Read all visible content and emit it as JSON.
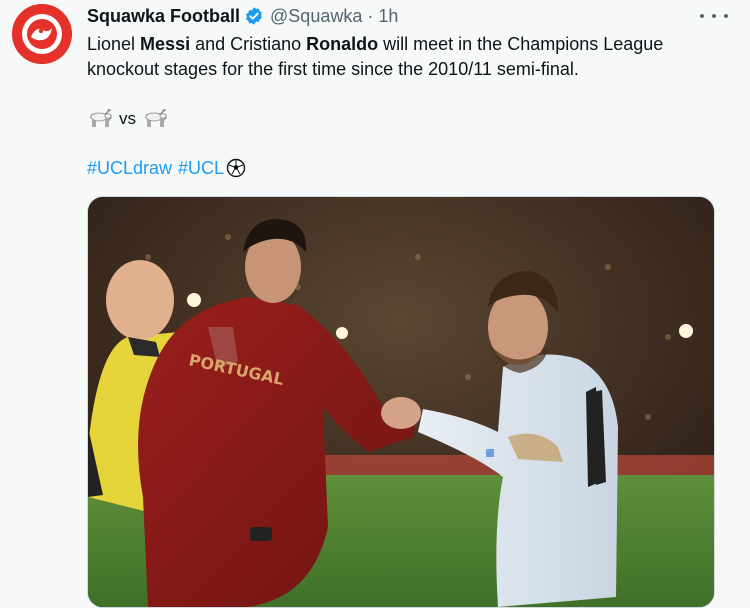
{
  "tweet": {
    "author_name": "Squawka Football",
    "handle": "@Squawka",
    "separator": "·",
    "time": "1h",
    "text": {
      "line1_pre": "Lionel ",
      "line1_bold1": "Messi",
      "line1_mid": " and Cristiano ",
      "line1_bold2": "Ronaldo",
      "line1_post": " will meet in the Champions League",
      "line2": "knockout stages for the first time since the 2010/11 semi-final."
    },
    "vs_text": "vs",
    "hashtags": [
      "#UCLdraw",
      "#UCL"
    ],
    "icons": {
      "avatar": "squawka-logo-icon",
      "verified": "verified-badge-icon",
      "more": "more-dots-icon",
      "goat": "goat-emoji-icon",
      "ball": "champions-league-ball-icon"
    },
    "photo_jersey_text": "PORTUGAL"
  },
  "colors": {
    "brand_red": "#e4322b",
    "link_blue": "#1d9bf0",
    "text_secondary": "#536471"
  }
}
